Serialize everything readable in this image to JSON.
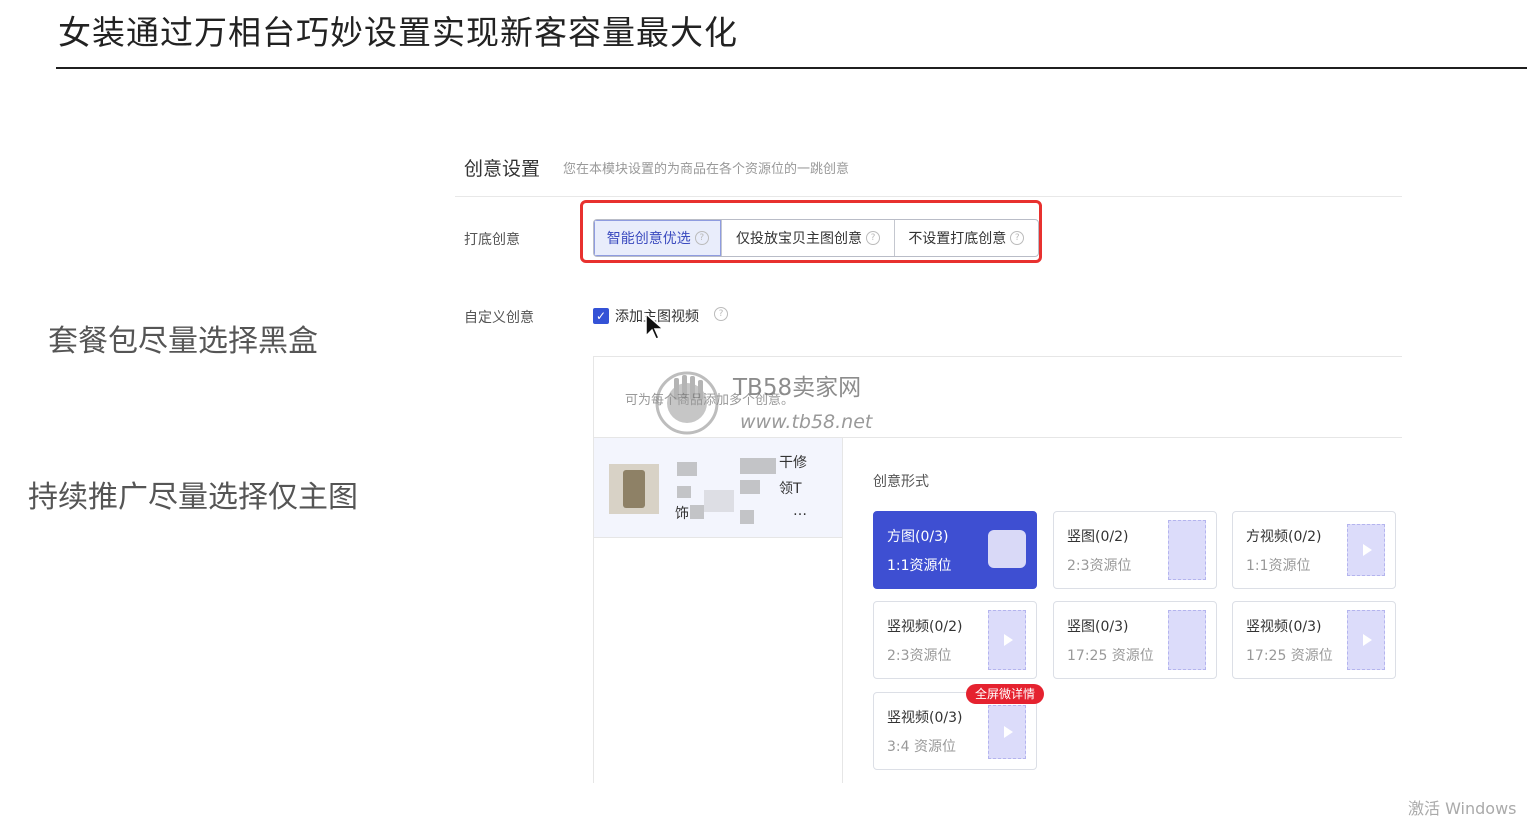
{
  "slide": {
    "title": "女装通过万相台巧妙设置实现新客容量最大化",
    "notes": [
      "套餐包尽量选择黑盒",
      "持续推广尽量选择仅主图"
    ]
  },
  "section": {
    "title": "创意设置",
    "desc": "您在本模块设置的为商品在各个资源位的一跳创意"
  },
  "base_creative": {
    "label": "打底创意",
    "options": [
      {
        "label": "智能创意优选",
        "active": true
      },
      {
        "label": "仅投放宝贝主图创意",
        "active": false
      },
      {
        "label": "不设置打底创意",
        "active": false
      }
    ]
  },
  "custom_creative": {
    "label": "自定义创意",
    "checkbox_label": "添加主图视频",
    "checked": true
  },
  "panel": {
    "hint": "可为每个商品添加多个创意。",
    "product_text": [
      "干修",
      "领T",
      "饰",
      "…"
    ],
    "form_title": "创意形式",
    "cards": [
      {
        "name": "方图(0/3)",
        "sub": "1:1资源位",
        "selected": true,
        "kind": "image"
      },
      {
        "name": "竖图(0/2)",
        "sub": "2:3资源位",
        "selected": false,
        "kind": "image"
      },
      {
        "name": "方视频(0/2)",
        "sub": "1:1资源位",
        "selected": false,
        "kind": "video"
      },
      {
        "name": "竖视频(0/2)",
        "sub": "2:3资源位",
        "selected": false,
        "kind": "video"
      },
      {
        "name": "竖图(0/3)",
        "sub": "17:25 资源位",
        "selected": false,
        "kind": "image"
      },
      {
        "name": "竖视频(0/3)",
        "sub": "17:25 资源位",
        "selected": false,
        "kind": "video"
      },
      {
        "name": "竖视频(0/3)",
        "sub": "3:4 资源位",
        "selected": false,
        "kind": "video"
      }
    ],
    "badge": "全屏微详情"
  },
  "watermark": {
    "brand": "TB58卖家网",
    "url": "www.tb58.net"
  },
  "windows_watermark": "激活 Windows",
  "colors": {
    "accent": "#3e4fd2",
    "highlight_frame": "#e8312f",
    "badge": "#e5222f"
  }
}
